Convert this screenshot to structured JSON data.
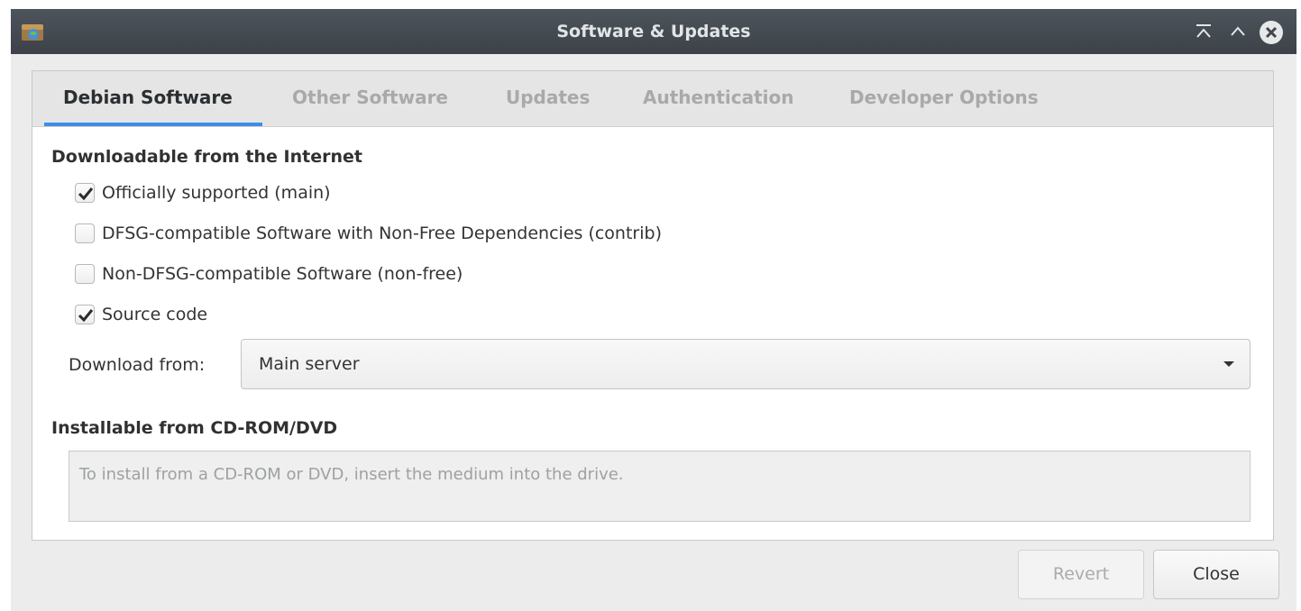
{
  "window": {
    "title": "Software & Updates"
  },
  "tabs": [
    {
      "label": "Debian Software",
      "active": true
    },
    {
      "label": "Other Software",
      "active": false
    },
    {
      "label": "Updates",
      "active": false
    },
    {
      "label": "Authentication",
      "active": false
    },
    {
      "label": "Developer Options",
      "active": false
    }
  ],
  "internet": {
    "heading": "Downloadable from the Internet",
    "options": [
      {
        "label": "Officially supported (main)",
        "checked": true
      },
      {
        "label": "DFSG-compatible Software with Non-Free Dependencies (contrib)",
        "checked": false
      },
      {
        "label": "Non-DFSG-compatible Software (non-free)",
        "checked": false
      },
      {
        "label": "Source code",
        "checked": true
      }
    ],
    "download_from_label": "Download from:",
    "download_from_value": "Main server"
  },
  "cdrom": {
    "heading": "Installable from CD-ROM/DVD",
    "message": "To install from a CD-ROM or DVD, insert the medium into the drive."
  },
  "buttons": {
    "revert": "Revert",
    "close": "Close"
  },
  "colors": {
    "titlebar": "#41474d",
    "accent": "#3d8ee8",
    "window_bg": "#ececec"
  }
}
